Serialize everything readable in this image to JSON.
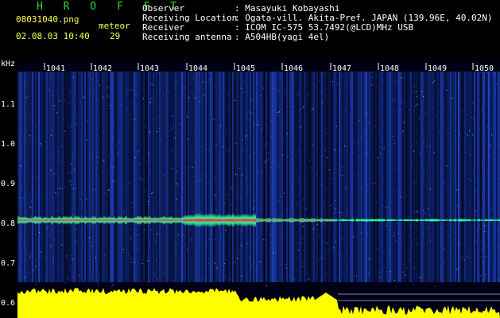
{
  "app": {
    "logo": "H R O F F T",
    "filename": "08031040.png",
    "datetime": "02.08.03 10:40",
    "meteor_label": "meteor",
    "meteor_count": "29"
  },
  "info": {
    "observer_label": "Observer",
    "observer_value": ": Masayuki Kobayashi",
    "location_label": "Receiving Location",
    "location_value": ": Ogata-vill. Akita-Pref. JAPAN (139.96E, 40.02N)",
    "receiver_label": "Receiver",
    "receiver_value": ": ICOM IC-575 53.7492(@LCD)MHz USB",
    "antenna_label": "Receiving antenna",
    "antenna_value": ": A504HB(yagi 4el)"
  },
  "spectrogram": {
    "unit_label": "kHz",
    "time_ticks": [
      "1041",
      "1042",
      "1043",
      "1044",
      "1045",
      "1046",
      "1047",
      "1048",
      "1049",
      "1050"
    ],
    "freq_ticks": [
      "1.1",
      "1.0",
      "0.9",
      "0.8",
      "0.7",
      "0.6"
    ],
    "colors": {
      "background": "#000014",
      "noise_blue": "#1a3cff",
      "echo_red": "#ff1e5a",
      "echo_green": "#28ff8c",
      "baseline_yellow": "#ffff00"
    }
  }
}
